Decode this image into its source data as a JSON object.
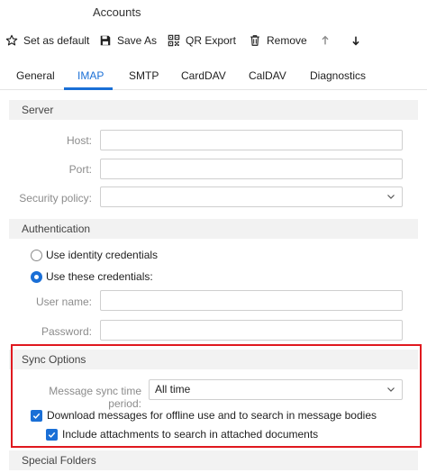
{
  "window": {
    "title": "Accounts"
  },
  "toolbar": {
    "set_default": "Set as default",
    "save_as": "Save As",
    "qr_export": "QR Export",
    "remove": "Remove"
  },
  "tabs": [
    {
      "label": "General"
    },
    {
      "label": "IMAP",
      "active": true
    },
    {
      "label": "SMTP"
    },
    {
      "label": "CardDAV"
    },
    {
      "label": "CalDAV"
    },
    {
      "label": "Diagnostics"
    }
  ],
  "server": {
    "header": "Server",
    "host_label": "Host:",
    "host_value": "",
    "port_label": "Port:",
    "port_value": "",
    "security_label": "Security policy:",
    "security_value": ""
  },
  "auth": {
    "header": "Authentication",
    "option_identity": "Use identity credentials",
    "option_these": "Use these credentials:",
    "username_label": "User name:",
    "username_value": "",
    "password_label": "Password:",
    "password_value": ""
  },
  "sync": {
    "header": "Sync Options",
    "period_label": "Message sync time period:",
    "period_value": "All time",
    "download_label": "Download messages for offline use and to search in message bodies",
    "attachments_label": "Include attachments to search in attached documents"
  },
  "special": {
    "header": "Special Folders"
  },
  "colors": {
    "accent": "#1a6fd6",
    "highlight": "#e0191f"
  }
}
